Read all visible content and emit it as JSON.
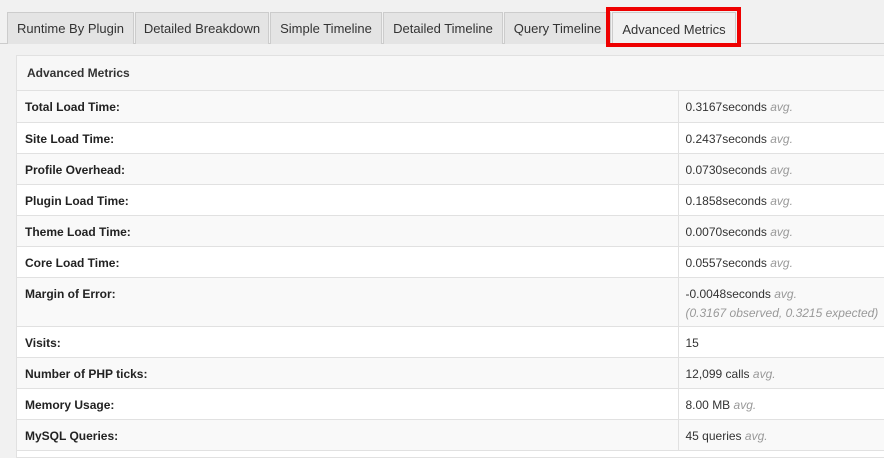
{
  "tabs": [
    {
      "label": "Runtime By Plugin"
    },
    {
      "label": "Detailed Breakdown"
    },
    {
      "label": "Simple Timeline"
    },
    {
      "label": "Detailed Timeline"
    },
    {
      "label": "Query Timeline"
    },
    {
      "label": "Advanced Metrics",
      "active": true
    }
  ],
  "highlight_color": "#ee0000",
  "panel": {
    "title": "Advanced Metrics",
    "rows": [
      {
        "label": "Total Load Time:",
        "value": "0.3167seconds",
        "suffix": "avg."
      },
      {
        "label": "Site Load Time:",
        "value": "0.2437seconds",
        "suffix": "avg."
      },
      {
        "label": "Profile Overhead:",
        "value": "0.0730seconds",
        "suffix": "avg."
      },
      {
        "label": "Plugin Load Time:",
        "value": "0.1858seconds",
        "suffix": "avg."
      },
      {
        "label": "Theme Load Time:",
        "value": "0.0070seconds",
        "suffix": "avg."
      },
      {
        "label": "Core Load Time:",
        "value": "0.0557seconds",
        "suffix": "avg."
      },
      {
        "label": "Margin of Error:",
        "value": "-0.0048seconds",
        "suffix": "avg.",
        "note": "(0.3167 observed, 0.3215 expected)"
      },
      {
        "label": "Visits:",
        "value": "15",
        "suffix": ""
      },
      {
        "label": "Number of PHP ticks:",
        "value": "12,099 calls",
        "suffix": "avg."
      },
      {
        "label": "Memory Usage:",
        "value": "8.00 MB",
        "suffix": "avg."
      },
      {
        "label": "MySQL Queries:",
        "value": "45 queries",
        "suffix": "avg."
      }
    ]
  }
}
